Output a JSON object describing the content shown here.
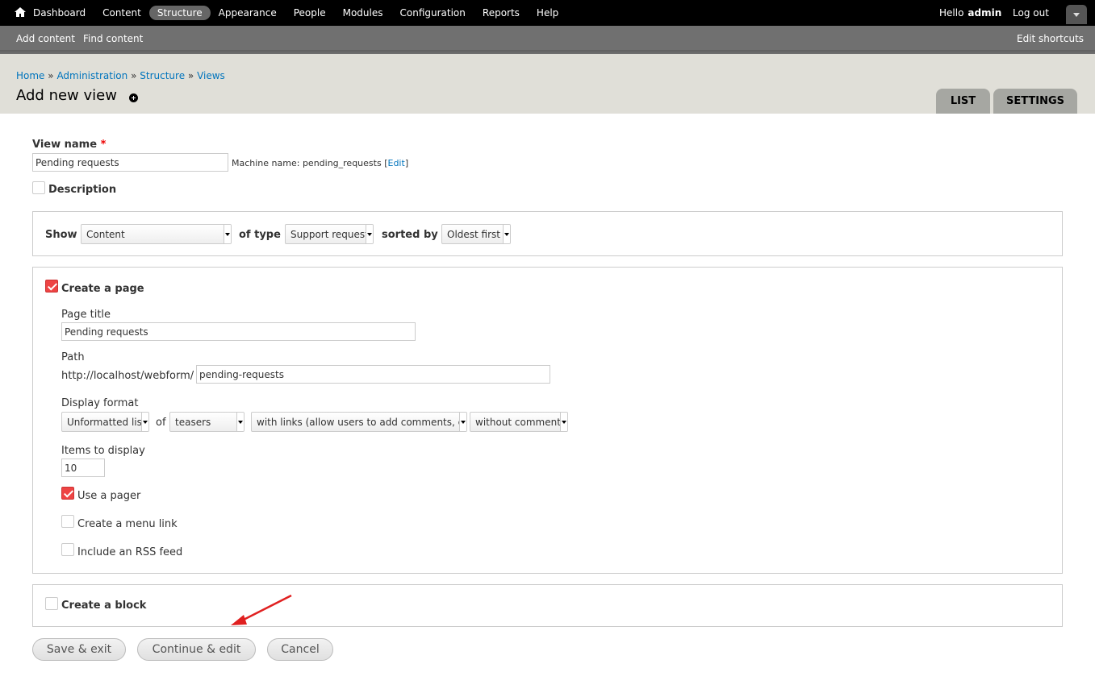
{
  "toolbar": {
    "home_icon": "home-icon",
    "menu": [
      "Dashboard",
      "Content",
      "Structure",
      "Appearance",
      "People",
      "Modules",
      "Configuration",
      "Reports",
      "Help"
    ],
    "active": "Structure",
    "hello": "Hello",
    "username": "admin",
    "logout": "Log out",
    "drawer_icon": "chevron-down-icon"
  },
  "shortcuts": {
    "add_content": "Add content",
    "find_content": "Find content",
    "edit_shortcuts": "Edit shortcuts"
  },
  "breadcrumb": [
    "Home",
    "Administration",
    "Structure",
    "Views"
  ],
  "breadcrumb_separator": "»",
  "page": {
    "title": "Add new view",
    "tabs": [
      "LIST",
      "SETTINGS"
    ]
  },
  "form": {
    "view_name_label": "View name",
    "required_mark": "*",
    "view_name_value": "Pending requests",
    "machine_name_prefix": "Machine name: pending_requests",
    "machine_name_edit": "Edit",
    "description_label": "Description",
    "show": {
      "show_label": "Show",
      "show_value": "Content",
      "of_type_label": "of type",
      "type_value": "Support request",
      "sorted_by_label": "sorted by",
      "sort_value": "Oldest first"
    },
    "page": {
      "create_label": "Create a page",
      "create_checked": true,
      "title_label": "Page title",
      "title_value": "Pending requests",
      "path_label": "Path",
      "path_prefix": "http://localhost/webform/",
      "path_value": "pending-requests",
      "display_format_label": "Display format",
      "format_value": "Unformatted list",
      "of_label": "of",
      "row_value": "teasers",
      "links_value": "with links (allow users to add comments, etc.)",
      "comments_value": "without comments",
      "items_label": "Items to display",
      "items_value": "10",
      "pager_label": "Use a pager",
      "pager_checked": true,
      "menu_link_label": "Create a menu link",
      "rss_label": "Include an RSS feed"
    },
    "block": {
      "create_label": "Create a block"
    },
    "buttons": {
      "save_exit": "Save & exit",
      "continue_edit": "Continue & edit",
      "cancel": "Cancel"
    }
  },
  "annotation_color": "#e02020"
}
